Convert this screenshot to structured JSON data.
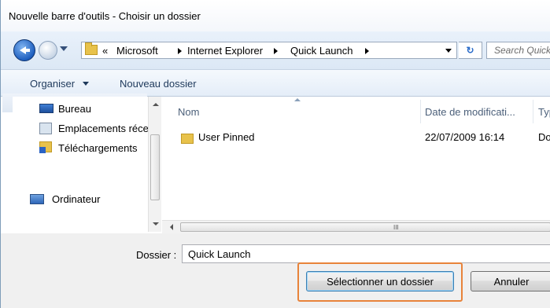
{
  "window": {
    "title": "Nouvelle barre d'outils - Choisir un dossier"
  },
  "address": {
    "overflow": "«",
    "crumbs": [
      "Microsoft",
      "Internet Explorer",
      "Quick Launch"
    ],
    "search_placeholder": "Search Quick Launch"
  },
  "toolbar": {
    "organize_label": "Organiser",
    "new_folder_label": "Nouveau dossier"
  },
  "nav_pane": {
    "items": [
      {
        "label": "Bureau",
        "icon": "desktop-icon"
      },
      {
        "label": "Emplacements récents",
        "icon": "recent-places-icon"
      },
      {
        "label": "Téléchargements",
        "icon": "downloads-icon"
      }
    ],
    "computer": {
      "label": "Ordinateur",
      "icon": "computer-icon"
    }
  },
  "file_list": {
    "columns": [
      "Nom",
      "Date de modificati...",
      "Type"
    ],
    "rows": [
      {
        "name": "User Pinned",
        "date": "22/07/2009 16:14",
        "type": "Dossier de fichiers",
        "icon": "folder-icon"
      }
    ]
  },
  "scrollbar": {
    "grip": "III"
  },
  "footer": {
    "folder_label": "Dossier :",
    "folder_value": "Quick Launch",
    "select_button": "Sélectionner un dossier",
    "cancel_button": "Annuler"
  },
  "colors": {
    "highlight": "#e8833a",
    "accent": "#1f5fbf",
    "folder": "#e8c24b"
  }
}
